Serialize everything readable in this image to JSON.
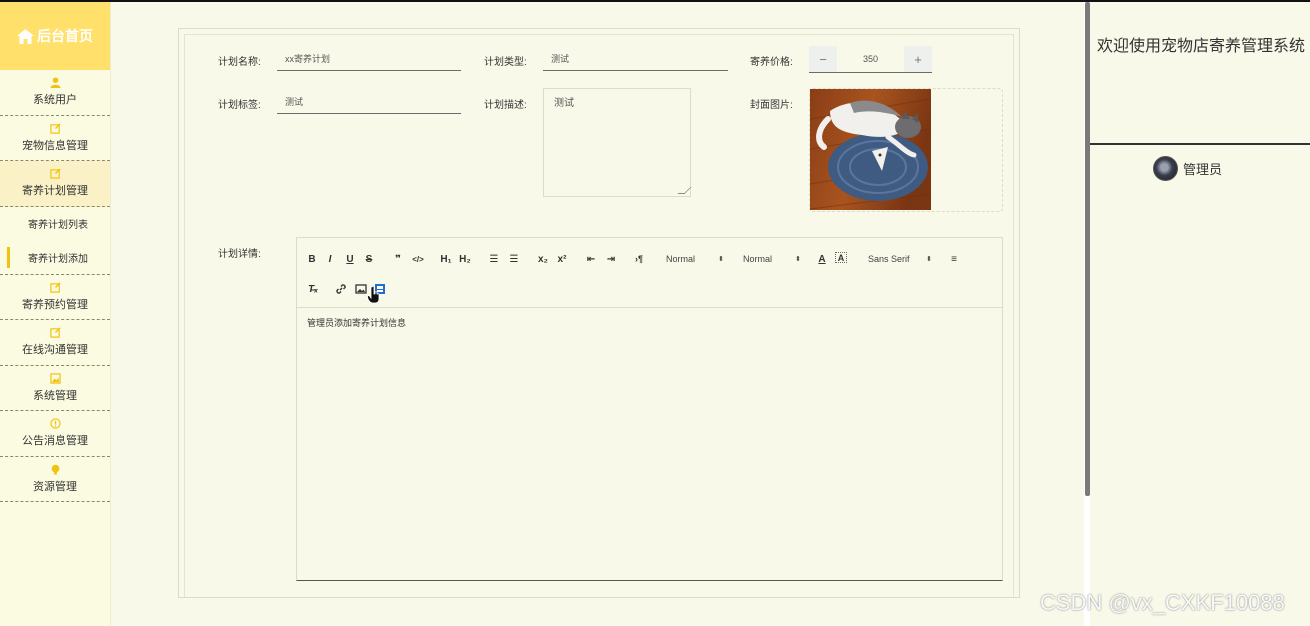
{
  "sidebar": {
    "title": "后台首页",
    "items": [
      {
        "label": "系统用户"
      },
      {
        "label": "宠物信息管理"
      },
      {
        "label": "寄养计划管理"
      },
      {
        "label": "寄养预约管理"
      },
      {
        "label": "在线沟通管理"
      },
      {
        "label": "系统管理"
      },
      {
        "label": "公告消息管理"
      },
      {
        "label": "资源管理"
      }
    ],
    "subitems": [
      {
        "label": "寄养计划列表"
      },
      {
        "label": "寄养计划添加"
      }
    ]
  },
  "form": {
    "name_label": "计划名称:",
    "name_value": "xx寄养计划",
    "type_label": "计划类型:",
    "type_value": "测试",
    "price_label": "寄养价格:",
    "price_value": "350",
    "minus": "−",
    "plus": "+",
    "tag_label": "计划标签:",
    "tag_value": "测试",
    "desc_label": "计划描述:",
    "desc_value": "测试",
    "cover_label": "封面图片:",
    "detail_label": "计划详情:"
  },
  "editor": {
    "header_picker": "Normal",
    "size_picker": "Normal",
    "font_picker": "Sans Serif",
    "content": "管理员添加寄养计划信息"
  },
  "header": {
    "welcome": "欢迎使用宠物店寄养管理系统",
    "user": "管理员"
  },
  "watermark": "CSDN @vx_CXKF10088",
  "colors": {
    "accent": "#f3c20f",
    "brand_bg": "#ffe06b",
    "page_bg": "#f8f9e8"
  }
}
